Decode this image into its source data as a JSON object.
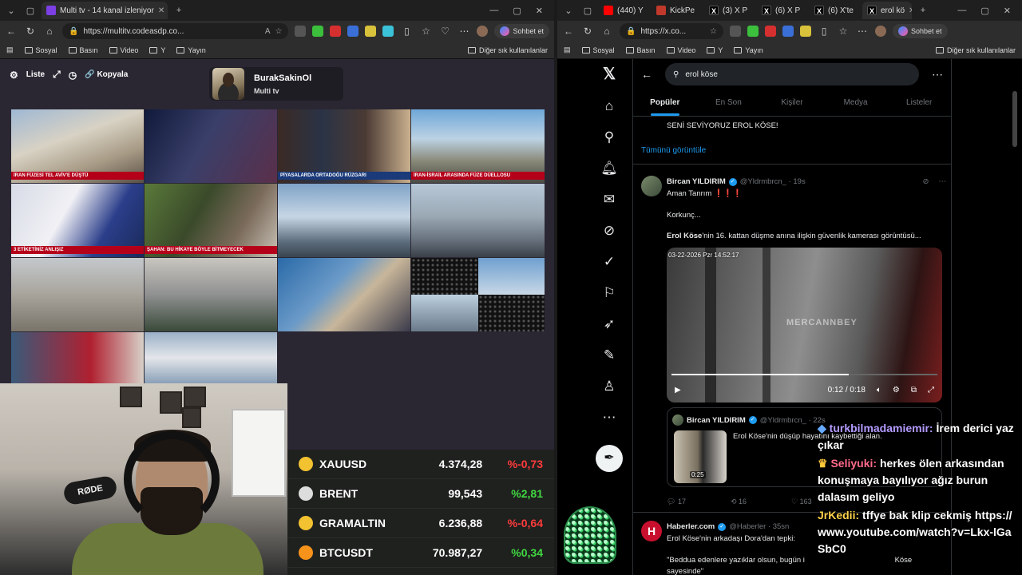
{
  "left_browser": {
    "tab_title": "Multi tv - 14 kanal izleniyor",
    "url": "https://multitv.codeasdp.co...",
    "chat_button": "Sohbet et",
    "bookmarks": [
      "Sosyal",
      "Basın",
      "Video",
      "Y",
      "Yayın"
    ],
    "other_bookmarks": "Diğer sık kullanılanlar"
  },
  "right_browser": {
    "tabs": [
      "(440) Y",
      "KickPe",
      "(3) X P",
      "(6) X P",
      "(6) X'te",
      "erol kö"
    ],
    "url": "https://x.co...",
    "chat_button": "Sohbet et",
    "bookmarks": [
      "Sosyal",
      "Basın",
      "Video",
      "Y",
      "Yayın"
    ],
    "other_bookmarks": "Diğer sık kullanılanlar"
  },
  "multitv": {
    "toolbar": {
      "list_label": "Liste",
      "copy_label": "Kopyala"
    },
    "channel": {
      "name": "BurakSakinOl",
      "subtitle": "Multi tv"
    },
    "captions": {
      "t1": "İRAN FÜZESİ TEL AVİV'E DÜŞTÜ",
      "t3": "PİYASALARDA ORTADOĞU RÜZGARI",
      "t4": "İRAN-İSRAİL ARASINDA FÜZE DÜELLOSU",
      "t5": "3 ETİKETİNİZ ANLIŞIZ",
      "t6": "ŞAHAN: BU HİKAYE BÖYLE BİTMEYECEK"
    }
  },
  "ticker": [
    {
      "icon": "gold-bar-icon",
      "symbol": "XAUUSD",
      "value": "4.374,28",
      "change": "%-0,73",
      "dir": "neg",
      "color": "#f2c230"
    },
    {
      "icon": "oil-barrel-icon",
      "symbol": "BRENT",
      "value": "99,543",
      "change": "%2,81",
      "dir": "pos",
      "color": "#dddddd"
    },
    {
      "icon": "gold-gram-icon",
      "symbol": "GRAMALTIN",
      "value": "6.236,88",
      "change": "%-0,64",
      "dir": "neg",
      "color": "#f2c230"
    },
    {
      "icon": "bitcoin-icon",
      "symbol": "BTCUSDT",
      "value": "70.987,27",
      "change": "%0,34",
      "dir": "pos",
      "color": "#f7931a"
    }
  ],
  "webcam": {
    "mic_brand": "RØDE"
  },
  "xapp": {
    "search_query": "erol köse",
    "tabs": [
      "Popüler",
      "En Son",
      "Kişiler",
      "Medya",
      "Listeler"
    ],
    "prev_tweet_text": "SENİ SEVİYORUZ EROL KÖSE!",
    "see_all": "Tümünü görüntüle",
    "tweet": {
      "name": "Bircan YILDIRIM",
      "handle": "@Yldrmbrcn_ · 19s",
      "line1": "Aman Tanrım ❗❗❗",
      "line2": "Korkunç...",
      "line3_bold": "Erol Köse",
      "line3_rest": "'nin 16. kattan düşme anına ilişkin güvenlik kamerası görüntüsü...",
      "video_time": "0:12 / 0:18",
      "video_timestamp": "03-22-2026 Pzr 14:52:17",
      "watermark": "MERCANNBEY"
    },
    "quote": {
      "name": "Bircan YILDIRIM",
      "handle": "@Yldrmbrcn_ · 22s",
      "text": "Erol Köse'nin düşüp hayatını kaybettiği alan.",
      "duration": "0:25"
    },
    "actions": {
      "replies": "17",
      "reposts": "16",
      "likes": "163"
    },
    "next_tweet": {
      "name": "Haberler.com",
      "handle": "@Haberler · 35sn",
      "line1": "Erol Köse'nin arkadaşı Dora'dan tepki:",
      "line2": "\"Beddua edenlere yazıklar olsun, bugün i",
      "line2_end": "Köse",
      "line3": "sayesinde\""
    }
  },
  "chat": [
    {
      "user": "turkbilmadamiemir:",
      "text": "İrem derici yaz çıkar"
    },
    {
      "user": "Seliyuki:",
      "text": "herkes ölen arkasından konuşmaya bayılıyor ağız burun dalasım geliyo"
    },
    {
      "user": "JrKedii:",
      "text": "tffye bak klip cekmiş https://www.youtube.com/watch?v=Lkx-lGaSbC0"
    }
  ]
}
